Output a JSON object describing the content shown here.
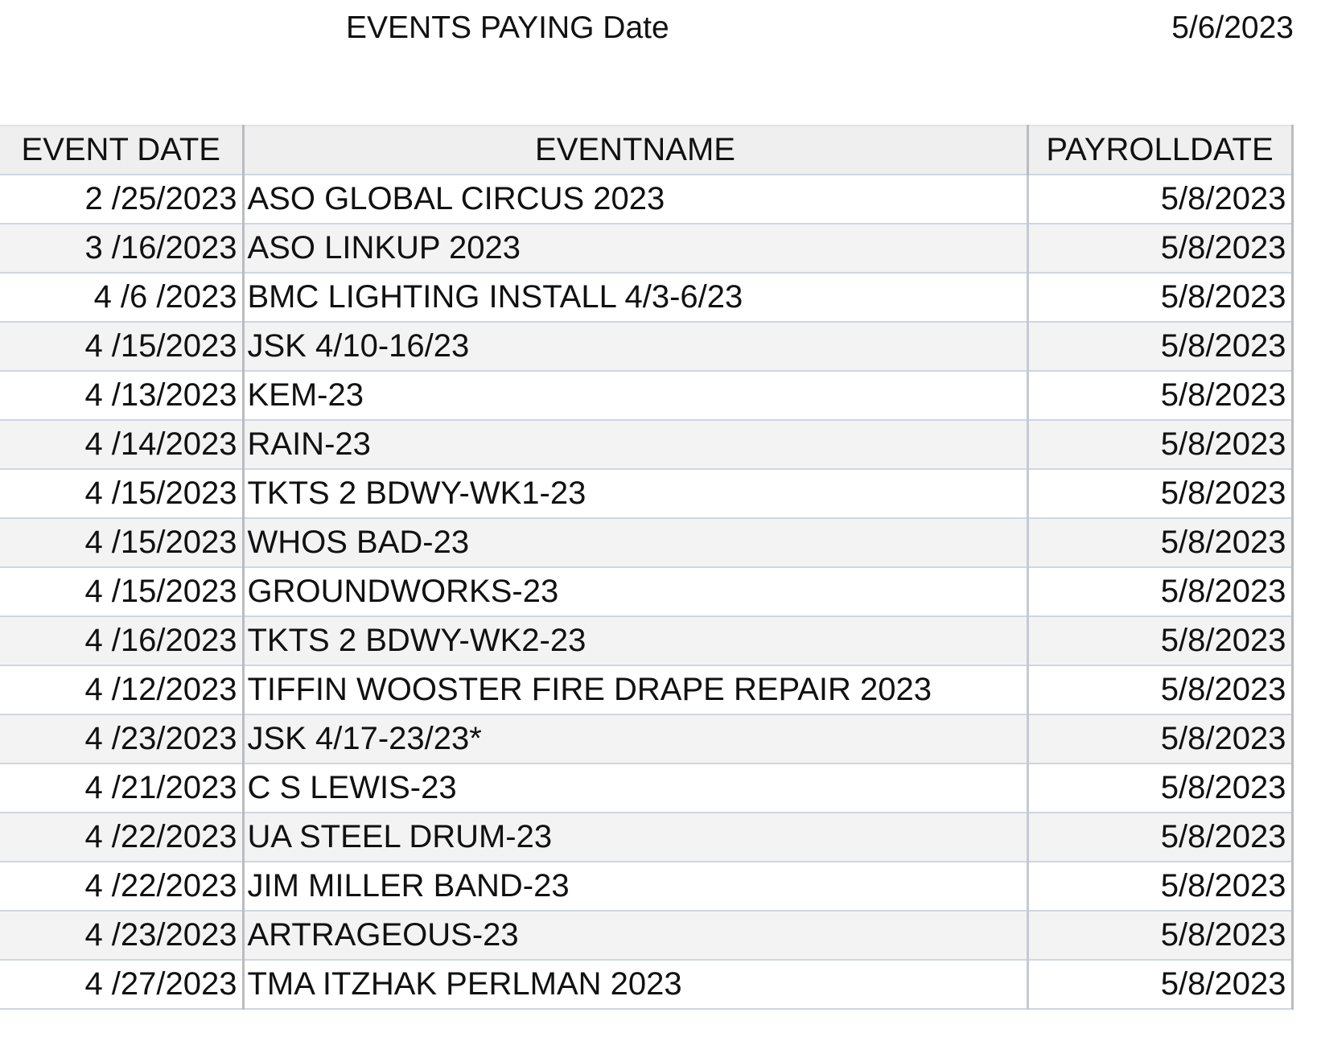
{
  "header": {
    "title": "EVENTS PAYING Date",
    "paying_date": "5/6/2023"
  },
  "table": {
    "columns": [
      "EVENT DATE",
      "EVENTNAME",
      "PAYROLLDATE"
    ],
    "rows": [
      {
        "event_date": "2 /25/2023",
        "event_name": "ASO GLOBAL CIRCUS 2023",
        "payroll_date": "5/8/2023"
      },
      {
        "event_date": "3 /16/2023",
        "event_name": "ASO LINKUP 2023",
        "payroll_date": "5/8/2023"
      },
      {
        "event_date": "4 /6 /2023",
        "event_name": "BMC LIGHTING INSTALL 4/3-6/23",
        "payroll_date": "5/8/2023"
      },
      {
        "event_date": "4 /15/2023",
        "event_name": "JSK 4/10-16/23",
        "payroll_date": "5/8/2023"
      },
      {
        "event_date": "4 /13/2023",
        "event_name": "KEM-23",
        "payroll_date": "5/8/2023"
      },
      {
        "event_date": "4 /14/2023",
        "event_name": "RAIN-23",
        "payroll_date": "5/8/2023"
      },
      {
        "event_date": "4 /15/2023",
        "event_name": "TKTS 2 BDWY-WK1-23",
        "payroll_date": "5/8/2023"
      },
      {
        "event_date": "4 /15/2023",
        "event_name": "WHOS BAD-23",
        "payroll_date": "5/8/2023"
      },
      {
        "event_date": "4 /15/2023",
        "event_name": "GROUNDWORKS-23",
        "payroll_date": "5/8/2023"
      },
      {
        "event_date": "4 /16/2023",
        "event_name": "TKTS 2 BDWY-WK2-23",
        "payroll_date": "5/8/2023"
      },
      {
        "event_date": "4 /12/2023",
        "event_name": "TIFFIN WOOSTER FIRE DRAPE REPAIR 2023",
        "payroll_date": "5/8/2023"
      },
      {
        "event_date": "4 /23/2023",
        "event_name": "JSK 4/17-23/23*",
        "payroll_date": "5/8/2023"
      },
      {
        "event_date": "4 /21/2023",
        "event_name": "C S LEWIS-23",
        "payroll_date": "5/8/2023"
      },
      {
        "event_date": "4 /22/2023",
        "event_name": "UA STEEL DRUM-23",
        "payroll_date": "5/8/2023"
      },
      {
        "event_date": "4 /22/2023",
        "event_name": "JIM MILLER BAND-23",
        "payroll_date": "5/8/2023"
      },
      {
        "event_date": "4 /23/2023",
        "event_name": "ARTRAGEOUS-23",
        "payroll_date": "5/8/2023"
      },
      {
        "event_date": "4 /27/2023",
        "event_name": "TMA ITZHAK PERLMAN 2023",
        "payroll_date": "5/8/2023"
      }
    ]
  }
}
